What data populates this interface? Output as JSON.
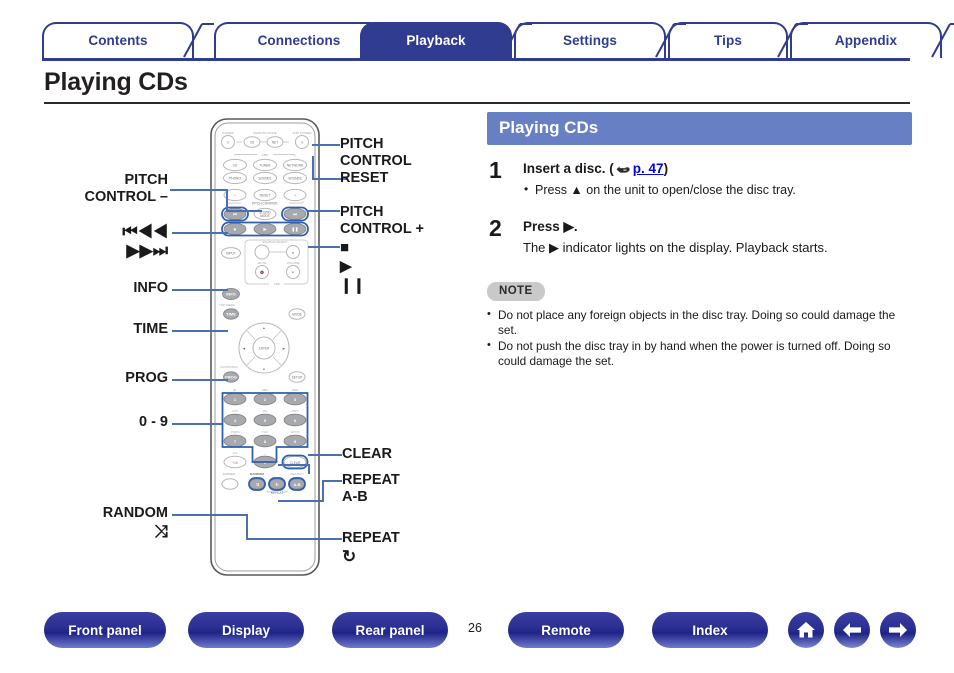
{
  "tabs": [
    {
      "label": "Contents",
      "active": false
    },
    {
      "label": "Connections",
      "active": false
    },
    {
      "label": "Playback",
      "active": true
    },
    {
      "label": "Settings",
      "active": false
    },
    {
      "label": "Tips",
      "active": false
    },
    {
      "label": "Appendix",
      "active": false
    }
  ],
  "page_title": "Playing CDs",
  "section": {
    "header": "Playing CDs",
    "steps": [
      {
        "num": "1",
        "title_before": "Insert a disc.  (",
        "link": "p. 47",
        "title_after": ")",
        "bullets": [
          "Press ▲ on the unit to open/close the disc tray."
        ]
      },
      {
        "num": "2",
        "title_before": "Press ▶.",
        "link": "",
        "title_after": "",
        "sub": "The ▶ indicator lights on the display. Playback starts.",
        "bullets": []
      }
    ],
    "note_label": "NOTE",
    "notes": [
      "Do not place any foreign objects in the disc tray. Doing so could damage the set.",
      "Do not push the disc tray in by hand when the power is turned off. Doing so could damage the set."
    ]
  },
  "callouts": {
    "pitch_control_minus": "PITCH\nCONTROL –",
    "skip_prev": "⏮◀◀",
    "skip_next": "▶▶⏭",
    "info": "INFO",
    "time": "TIME",
    "prog": "PROG",
    "numeric": "0 - 9",
    "random": "RANDOM",
    "random_symbol": "⤨",
    "pitch_control_reset": "PITCH\nCONTROL\nRESET",
    "pitch_control_plus": "PITCH\nCONTROL +",
    "transport_stop": "■",
    "transport_play": "▶",
    "transport_pause": "❙❙",
    "clear": "CLEAR",
    "repeat_ab": "REPEAT\nA-B",
    "repeat": "REPEAT",
    "repeat_symbol": "↻"
  },
  "callout_lines": {
    "pitch_minus_l1": "PITCH",
    "pitch_minus_l2": "CONTROL –",
    "pitch_reset_l1": "PITCH",
    "pitch_reset_l2": "CONTROL",
    "pitch_reset_l3": "RESET",
    "pitch_plus_l1": "PITCH",
    "pitch_plus_l2": "CONTROL +",
    "repeat_ab_l1": "REPEAT",
    "repeat_ab_l2": "A-B"
  },
  "remote": {
    "top_labels": {
      "power": "POWER",
      "remote_mode": "REMOTE MODE",
      "amp_power": "AMP POWER"
    },
    "source_group_label": "AMP",
    "source_buttons": [
      "CD",
      "TUNER",
      "NETWORK",
      "PHONO",
      "SOUND1",
      "SOUND2"
    ],
    "pitch_row": [
      "–",
      "RESET",
      "+"
    ],
    "pitch_label": "PITCH CONTROL",
    "transport_row1": [
      "⏮",
      "SOUND MODE",
      "⏭"
    ],
    "transport_row2": [
      "■",
      "▶",
      "❙❙"
    ],
    "input_label": "INPUT",
    "source_direct_label": "SOURCE DIRECT",
    "mute_label": "MUTE",
    "volume_label": "VOLUME",
    "amp_label": "AMP",
    "info_label": "INFO",
    "top_menu_label": "TOP MENU",
    "time_label": "TIME",
    "mode_label": "MODE",
    "enter_label": "ENTER",
    "favorites_label": "FAVORITES",
    "prog_label": "PROG",
    "setup_label": "SETUP",
    "keypad": [
      [
        {
          "k": "1",
          "s": "@."
        },
        {
          "k": "2",
          "s": "ABC"
        },
        {
          "k": "3",
          "s": "DEF"
        }
      ],
      [
        {
          "k": "4",
          "s": "GHI"
        },
        {
          "k": "5",
          "s": "JKL"
        },
        {
          "k": "6",
          "s": "MNO"
        }
      ],
      [
        {
          "k": "7",
          "s": "PQRS"
        },
        {
          "k": "8",
          "s": "TUV"
        },
        {
          "k": "9",
          "s": "WXYZ"
        }
      ],
      [
        {
          "k": "+10",
          "s": "A/a"
        },
        {
          "k": "0",
          "s": "␣"
        },
        {
          "k": "CLEAR",
          "s": ""
        }
      ]
    ],
    "dimmer_label": "DIMMER",
    "random_label": "RANDOM",
    "repeat_label": "REPEAT",
    "search_label": "SEARCH",
    "ab_label": "A-B"
  },
  "bottom": {
    "buttons": [
      "Front panel",
      "Display",
      "Rear panel",
      "Remote",
      "Index"
    ],
    "page_number": "26",
    "icons": [
      "home-icon",
      "arrow-left-icon",
      "arrow-right-icon"
    ]
  },
  "colors": {
    "tab_active": "#2f3c8f",
    "section_header": "#6780c4",
    "leader_line": "#4a6fb5",
    "note_badge": "#c9c9c9",
    "pill": "#2a2f92"
  }
}
